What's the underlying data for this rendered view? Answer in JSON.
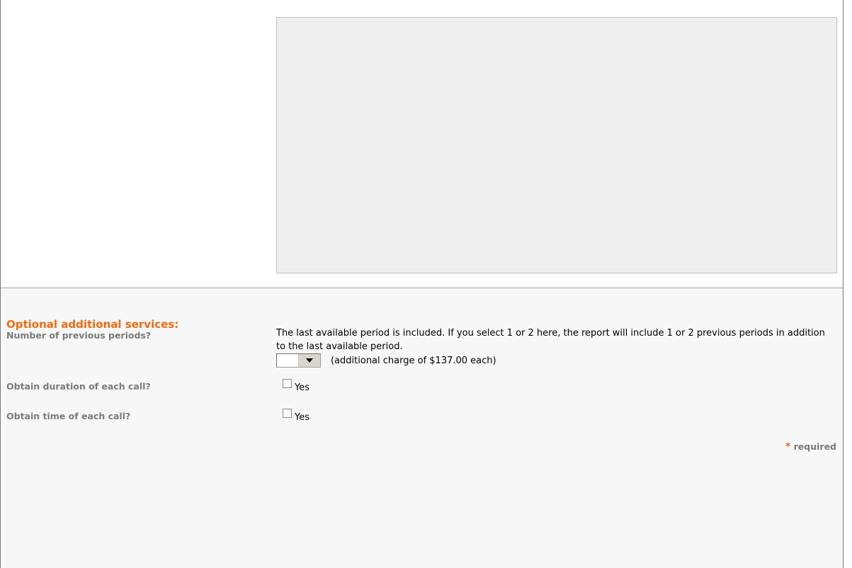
{
  "comments_box": {
    "value": ""
  },
  "optional_services": {
    "heading": "Optional additional services:",
    "previous_periods": {
      "label": "Number of previous periods?",
      "description": "The last available period is included. If you select 1 or 2 here, the report will include 1 or 2 previous periods in addition to the last available period.",
      "selected_value": "",
      "charge_note": "(additional charge of $137.00 each)"
    },
    "duration": {
      "label": "Obtain duration of each call?",
      "option_label": "Yes",
      "checked": false
    },
    "time": {
      "label": "Obtain time of each call?",
      "option_label": "Yes",
      "checked": false
    }
  },
  "footer": {
    "required_star": "*",
    "required_text": "required"
  },
  "colors": {
    "accent": "#f06a0f",
    "label_gray": "#7a7a7a",
    "section_bg": "#f7f7f7",
    "textarea_bg": "#efefef"
  }
}
